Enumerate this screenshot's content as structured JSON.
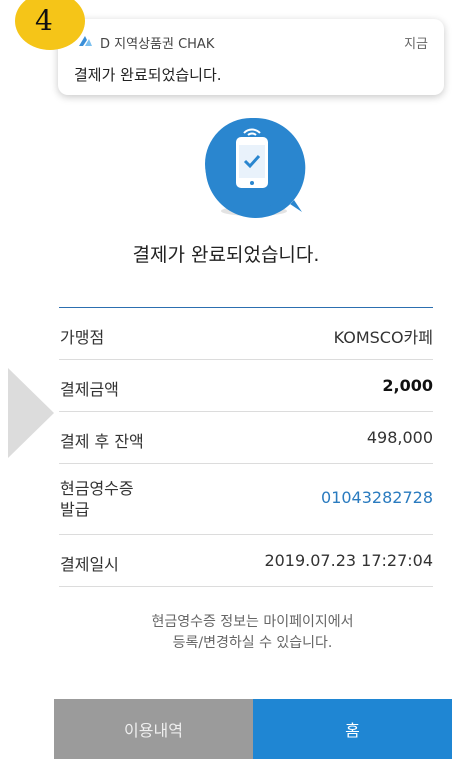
{
  "step_badge": "4",
  "notification": {
    "app_name": "D 지역상품권 CHAK",
    "time": "지금",
    "message": "결제가 완료되었습니다."
  },
  "main": {
    "icon": "phone-check-icon",
    "title": "결제가 완료되었습니다."
  },
  "details": [
    {
      "label": "가맹점",
      "value": "KOMSCO카페"
    },
    {
      "label": "결제금액",
      "value": "2,000"
    },
    {
      "label": "결제 후 잔액",
      "value": "498,000"
    },
    {
      "label": "현금영수증 발급",
      "label_line1": "현금영수증",
      "label_line2": "발급",
      "value": "01043282728"
    },
    {
      "label": "결제일시",
      "value": "2019.07.23 17:27:04"
    }
  ],
  "note": {
    "line1": "현금영수증 정보는 마이페이지에서",
    "line2": "등록/변경하실 수 있습니다."
  },
  "buttons": {
    "history": "이용내역",
    "home": "홈"
  },
  "colors": {
    "accent": "#1f86d3",
    "badge": "#f5c518",
    "link": "#2a7bbf",
    "grey_button": "#9b9b9b"
  }
}
